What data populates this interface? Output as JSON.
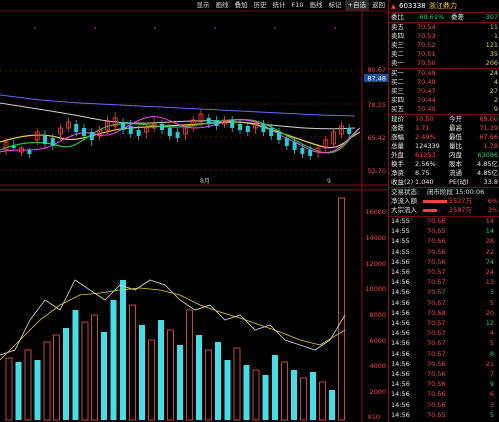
{
  "menu": [
    "显示",
    "画线",
    "叠加",
    "历史",
    "统计",
    "F10",
    "画线",
    "标记",
    "+自选",
    "返回"
  ],
  "stock": {
    "code": "603338",
    "name": "浙江鼎力"
  },
  "price_axis": {
    "top_label": "80.67",
    "current_tag": "87.48",
    "mid_label": "78.15",
    "low_label": "65.42",
    "bottom_label": "52.70"
  },
  "volume_axis": [
    "16000",
    "14000",
    "12000",
    "10000",
    "8000",
    "6000",
    "4000",
    "2000"
  ],
  "volume_unit": "X10",
  "date_markers": [
    "8月",
    "9"
  ],
  "webi": {
    "label": "委比",
    "value": "-69.61%",
    "label2": "委差",
    "value2": "-307"
  },
  "asks": [
    {
      "label": "卖五",
      "price": "70.54",
      "vol": "11"
    },
    {
      "label": "卖四",
      "price": "70.53",
      "vol": "1"
    },
    {
      "label": "卖三",
      "price": "70.52",
      "vol": "121"
    },
    {
      "label": "卖二",
      "price": "70.51",
      "vol": "35"
    },
    {
      "label": "卖一",
      "price": "70.50",
      "vol": "206"
    }
  ],
  "bids": [
    {
      "label": "买一",
      "price": "70.49",
      "vol": "24"
    },
    {
      "label": "买二",
      "price": "70.48",
      "vol": "4"
    },
    {
      "label": "买三",
      "price": "70.47",
      "vol": "27"
    },
    {
      "label": "买四",
      "price": "70.44",
      "vol": "2"
    },
    {
      "label": "买五",
      "price": "70.40",
      "vol": "9"
    }
  ],
  "quote": [
    {
      "l1": "现价",
      "v1": "70.50",
      "l2": "今开",
      "v2": "69.00"
    },
    {
      "l1": "涨跌",
      "v1": "1.71",
      "l2": "最高",
      "v2": "71.39"
    },
    {
      "l1": "涨幅",
      "v1": "2.49%",
      "l2": "最低",
      "v2": "67.66"
    },
    {
      "l1": "总量",
      "v1": "124339",
      "l2": "量比",
      "v2": "1.78"
    },
    {
      "l1": "外盘",
      "v1": "61253",
      "l2": "内盘",
      "v2": "63086"
    },
    {
      "l1": "换手",
      "v1": "2.56%",
      "l2": "股本",
      "v2": "4.85亿"
    },
    {
      "l1": "净资",
      "v1": "8.75",
      "l2": "流通",
      "v2": "4.85亿"
    },
    {
      "l1": "收益(2)",
      "v1": "1.040",
      "l2": "PE(动)",
      "v2": "33.8"
    }
  ],
  "status": {
    "label": "交易状态:",
    "value": "闭市阶段 15:00:06"
  },
  "flows": [
    {
      "label": "净流入额",
      "value": "5527万",
      "pct": "6%"
    },
    {
      "label": "大宗流入",
      "value": "2587万",
      "pct": "3%"
    }
  ],
  "ticks": [
    {
      "t": "14:55",
      "p": "70.56",
      "v": "14"
    },
    {
      "t": "14:55",
      "p": "70.55",
      "v": "14"
    },
    {
      "t": "14:55",
      "p": "70.56",
      "v": "28"
    },
    {
      "t": "14:55",
      "p": "70.56",
      "v": "22"
    },
    {
      "t": "14:56",
      "p": "70.56",
      "v": "74"
    },
    {
      "t": "14:56",
      "p": "70.57",
      "v": "24"
    },
    {
      "t": "14:56",
      "p": "70.57",
      "v": "13"
    },
    {
      "t": "14:56",
      "p": "70.57",
      "v": "3"
    },
    {
      "t": "14:56",
      "p": "70.57",
      "v": "5"
    },
    {
      "t": "14:56",
      "p": "70.58",
      "v": "20"
    },
    {
      "t": "14:56",
      "p": "70.57",
      "v": "12"
    },
    {
      "t": "14:56",
      "p": "70.57",
      "v": "4"
    },
    {
      "t": "14:56",
      "p": "70.57",
      "v": "5"
    },
    {
      "t": "14:56",
      "p": "70.57",
      "v": "8"
    },
    {
      "t": "14:56",
      "p": "70.56",
      "v": "21"
    },
    {
      "t": "14:56",
      "p": "70.56",
      "v": "7"
    },
    {
      "t": "14:56",
      "p": "70.56",
      "v": "9"
    },
    {
      "t": "14:56",
      "p": "70.56",
      "v": "6"
    },
    {
      "t": "14:56",
      "p": "70.56",
      "v": "3"
    },
    {
      "t": "14:56",
      "p": "70.55",
      "v": "5"
    }
  ],
  "colors": {
    "up": "#ff4040",
    "down": "#20d0d8",
    "ma5": "#ffffff",
    "ma10": "#e0d040",
    "ma20": "#ff40ff",
    "ma60": "#30c030"
  }
}
